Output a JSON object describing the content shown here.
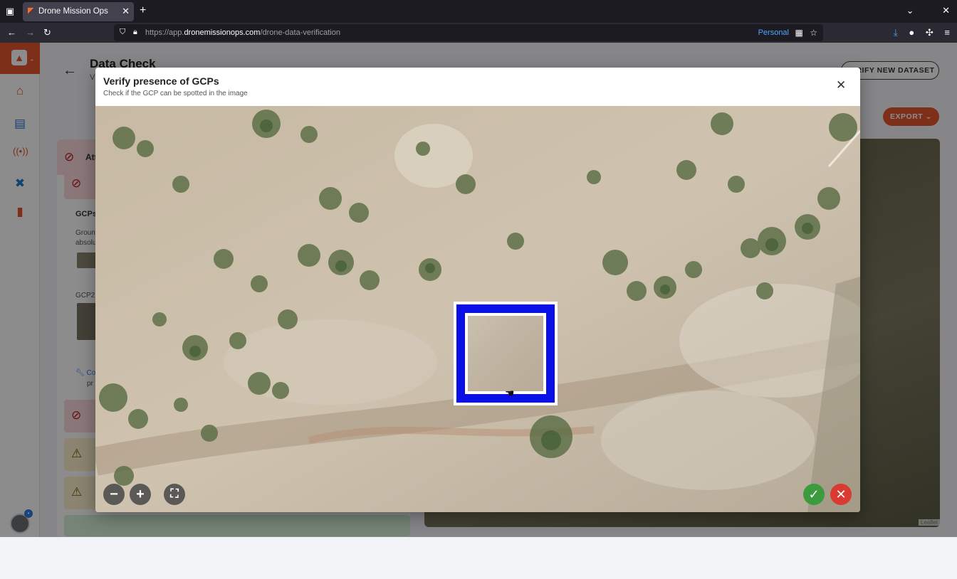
{
  "browser": {
    "tab_title": "Drone Mission Ops",
    "url_prefix": "https://app.",
    "url_domain": "dronemissionops.com",
    "url_path": "/drone-data-verification",
    "profile_label": "Personal"
  },
  "page": {
    "title": "Data Check",
    "subtitle": "V",
    "verify_new_dataset": "VERIFY NEW DATASET",
    "export": "EXPORT"
  },
  "left_panel": {
    "alert_title": "Att",
    "gcps_label": "GCPs",
    "gcps_desc_line1": "Groun",
    "gcps_desc_line2": "absolu",
    "gcp_item": "GCP2",
    "configure_link": "Co",
    "configure_line2": "pr"
  },
  "modal": {
    "title": "Verify presence of GCPs",
    "subtitle": "Check if the GCP can be spotted in the image"
  },
  "map": {
    "attribution": "Leaflet"
  },
  "colors": {
    "accent": "#e4572e",
    "gcp_marker": "#0a0fe6",
    "accept": "#3c9a3f",
    "reject": "#d93a32"
  }
}
